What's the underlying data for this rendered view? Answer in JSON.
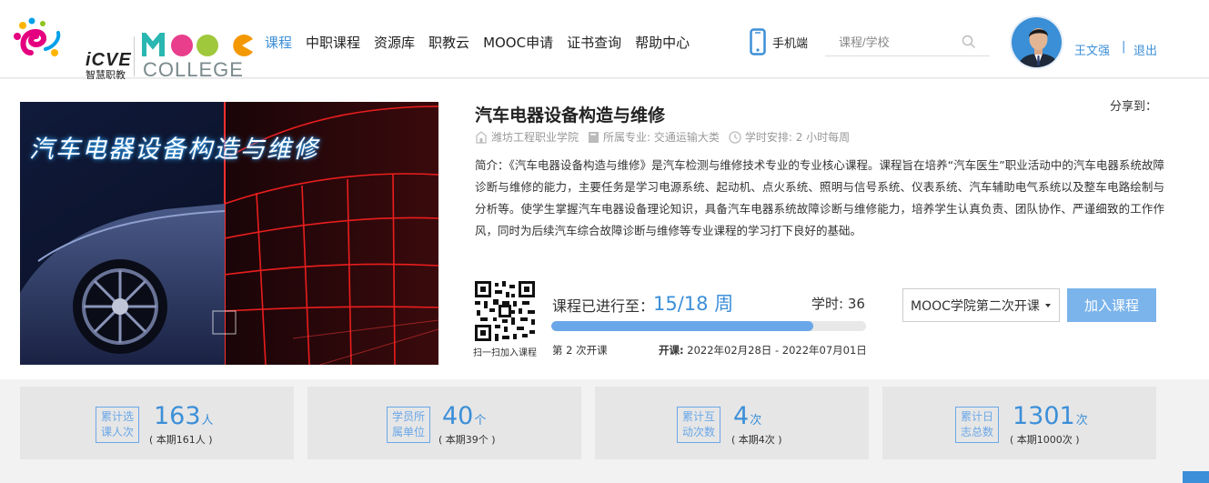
{
  "header": {
    "logo_icve": "iCVE",
    "logo_icve_sub": "智慧职教",
    "logo_mooc": "MOOC",
    "logo_college": "COLLEGE",
    "nav": [
      {
        "label": "课程",
        "active": true
      },
      {
        "label": "中职课程",
        "active": false
      },
      {
        "label": "资源库",
        "active": false
      },
      {
        "label": "职教云",
        "active": false
      },
      {
        "label": "MOOC申请",
        "active": false
      },
      {
        "label": "证书查询",
        "active": false
      },
      {
        "label": "帮助中心",
        "active": false
      }
    ],
    "mobile_label": "手机端",
    "search_placeholder": "课程/学校",
    "user_name": "王文强",
    "separator": "|",
    "logout_label": "退出"
  },
  "course": {
    "cover_title": "汽车电器设备构造与维修",
    "title": "汽车电器设备构造与维修",
    "share_label": "分享到：",
    "school": "潍坊工程职业学院",
    "major": "所属专业: 交通运输大类",
    "schedule": "学时安排: 2 小时每周",
    "intro": "简介：《汽车电器设备构造与维修》是汽车检测与维修技术专业的专业核心课程。课程旨在培养“汽车医生”职业活动中的汽车电器系统故障诊断与维修的能力，主要任务是学习电源系统、起动机、点火系统、照明与信号系统、仪表系统、汽车辅助电气系统以及整车电路绘制与分析等。使学生掌握汽车电器设备理论知识，具备汽车电器系统故障诊断与维修能力，培养学生认真负责、团队协作、严谨细致的工作作风，同时为后续汽车综合故障诊断与维修等专业课程的学习打下良好的基础。",
    "qr_label": "扫一扫加入课程",
    "progress_label": "课程已进行至：",
    "progress_value": "15/18 周",
    "progress_fraction": 0.833,
    "hours_label": "学时: 36",
    "run_no": "第 2 次开课",
    "open_label": "开课:",
    "open_dates": "2022年02月28日 - 2022年07月01日",
    "session_select": "MOOC学院第二次开课",
    "join_label": "加入课程"
  },
  "stats": [
    {
      "badge": [
        "累计选",
        "课人次"
      ],
      "value": "163",
      "unit": "人",
      "sub": "( 本期161人 )"
    },
    {
      "badge": [
        "学员所",
        "属单位"
      ],
      "value": "40",
      "unit": "个",
      "sub": "( 本期39个 )"
    },
    {
      "badge": [
        "累计互",
        "动次数"
      ],
      "value": "4",
      "unit": "次",
      "sub": "( 本期4次 )"
    },
    {
      "badge": [
        "累计日",
        "志总数"
      ],
      "value": "1301",
      "unit": "次",
      "sub": "( 本期1000次 )"
    }
  ]
}
